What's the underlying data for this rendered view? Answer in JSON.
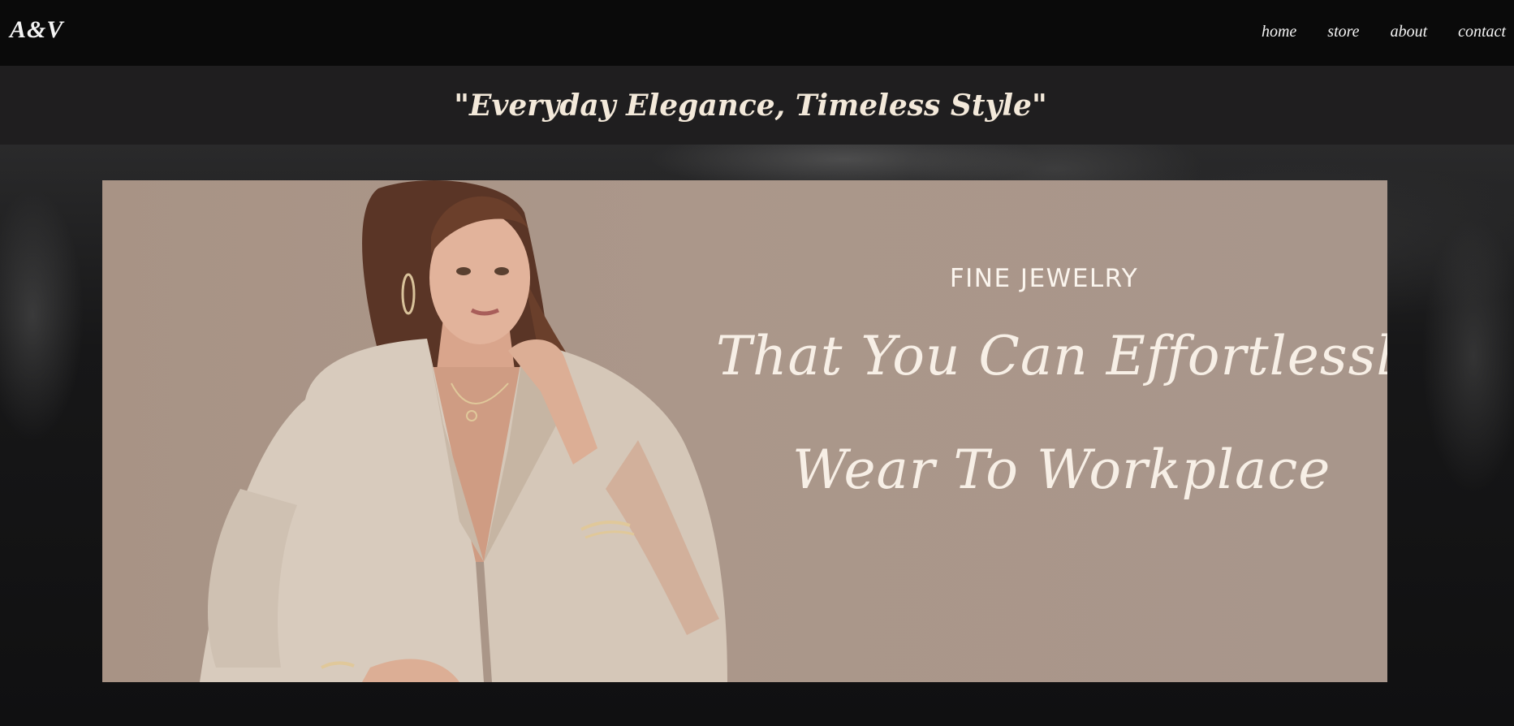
{
  "header": {
    "logo": "A&V",
    "nav": [
      {
        "label": "home"
      },
      {
        "label": "store"
      },
      {
        "label": "about"
      },
      {
        "label": "contact"
      }
    ]
  },
  "tagline": "\"Everyday Elegance, Timeless Style\"",
  "hero": {
    "heading": "FINE JEWELRY",
    "script_line_1": "That You Can Effortlessly",
    "script_line_2": "Wear To Workplace"
  }
}
